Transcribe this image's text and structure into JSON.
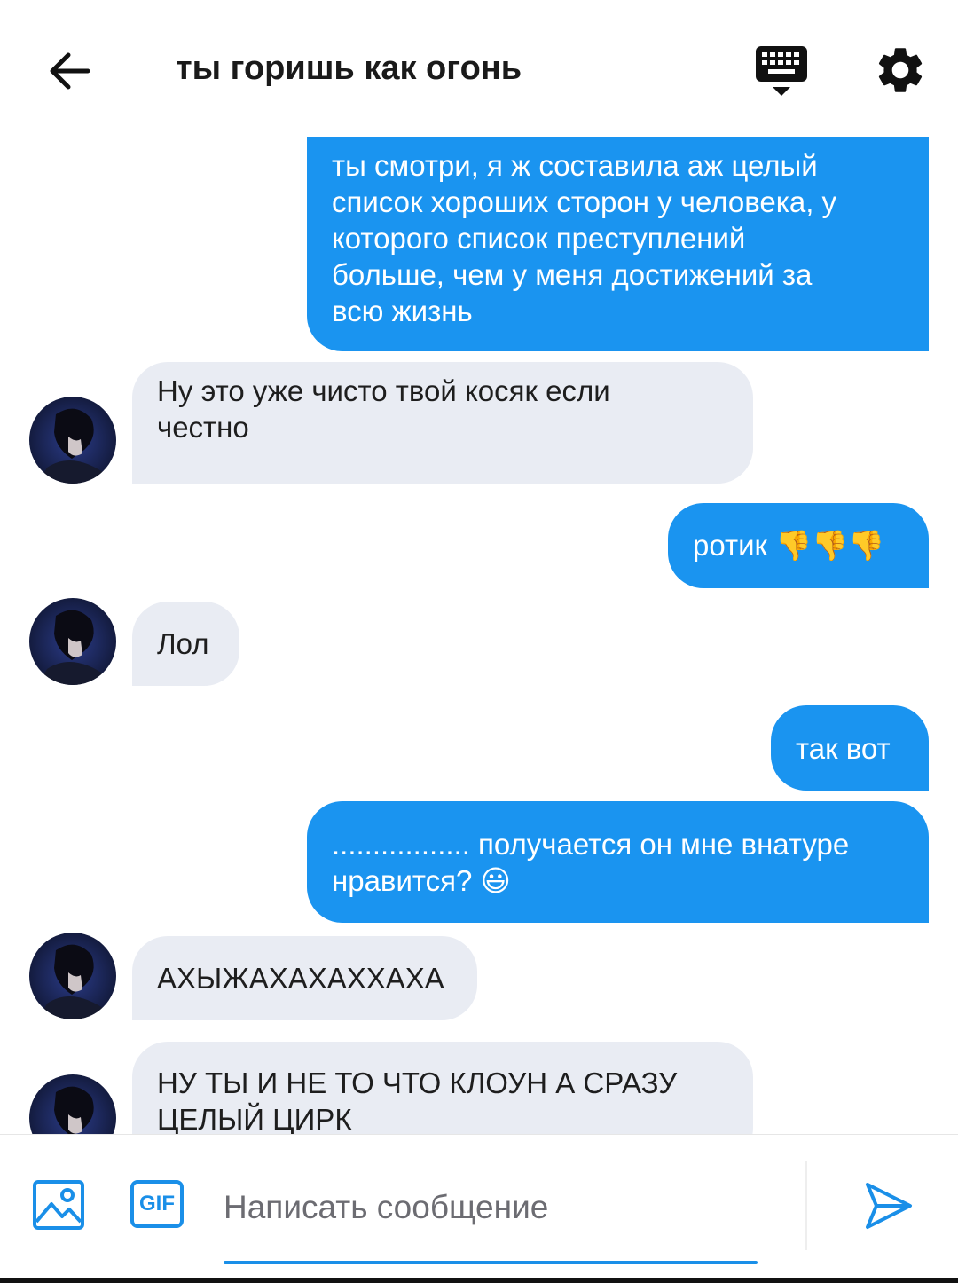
{
  "header": {
    "title": "ты горишь как огонь",
    "back_icon": "arrow-left-icon",
    "keyboard_icon": "keyboard-hide-icon",
    "settings_icon": "gear-icon"
  },
  "messages": [
    {
      "direction": "outgoing",
      "text": "ты смотри, я ж составила аж целый\nсписок хороших сторон у человека, у\nкоторого список преступлений\nбольше, чем у меня достижений за\nвсю жизнь"
    },
    {
      "direction": "incoming",
      "text": "Ну это уже чисто твой косяк если\nчестно"
    },
    {
      "direction": "outgoing",
      "text": "ротик 👎👎👎"
    },
    {
      "direction": "incoming",
      "text": "Лол"
    },
    {
      "direction": "outgoing",
      "text": "так вот"
    },
    {
      "direction": "outgoing",
      "text": "................. получается он мне внатуре\nнравится? 😃"
    },
    {
      "direction": "incoming",
      "text": "АХЫЖАХАХАХХАХА"
    },
    {
      "direction": "incoming",
      "text": "НУ ТЫ И НЕ ТО ЧТО КЛОУН А СРАЗУ\nЦЕЛЫЙ ЦИРК"
    }
  ],
  "composer": {
    "placeholder": "Написать сообщение",
    "gif_label": "GIF",
    "image_icon": "image-icon",
    "send_icon": "send-icon"
  },
  "colors": {
    "accent": "#1a94f0",
    "incoming_bubble": "#e9ecf3",
    "outgoing_text": "#ffffff"
  }
}
